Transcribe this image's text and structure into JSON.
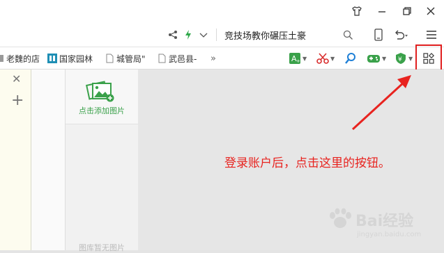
{
  "address_bar": {
    "search_text": "竞技场教你碾压土豪"
  },
  "bookmarks": [
    {
      "label": "老魏的店"
    },
    {
      "label": "国家园林"
    },
    {
      "label": "城管局\""
    },
    {
      "label": "武邑县-"
    }
  ],
  "bookmarks_more": "»",
  "left_panel": {
    "close_glyph": "✕",
    "add_glyph": "+"
  },
  "image_panel": {
    "add_image_label": "点击添加图片",
    "empty_label": "图库暂无图片"
  },
  "annotation": {
    "text": "登录账户后，点击这里的按钮。"
  },
  "watermark": {
    "brand": "Bai经验",
    "url": "jingyan.baidu.com"
  },
  "colors": {
    "accent_green": "#3aa14a",
    "annotation_red": "#e8231f"
  }
}
